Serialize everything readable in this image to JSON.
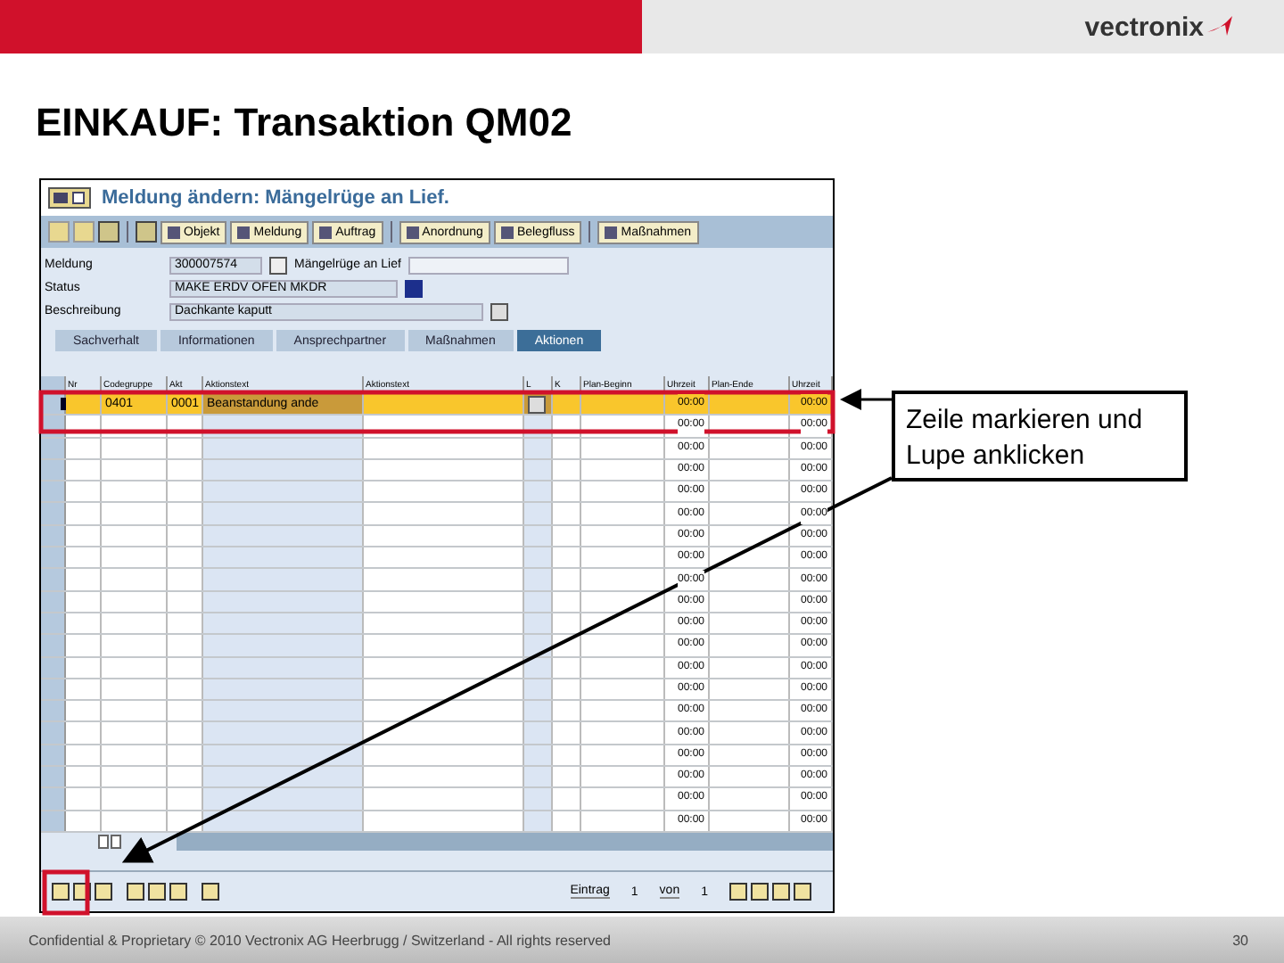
{
  "slide": {
    "logo": "vectronix",
    "title": "EINKAUF: Transaktion QM02",
    "footer": "Confidential & Proprietary © 2010 Vectronix AG Heerbrugg / Switzerland - All rights reserved",
    "page_number": "30"
  },
  "callout": {
    "text": "Zeile markieren und Lupe anklicken"
  },
  "sap_window": {
    "title": "Meldung ändern: Mängelrüge an Lief.",
    "toolbar_buttons": [
      "Objekt",
      "Meldung",
      "Auftrag",
      "Anordnung",
      "Belegfluss",
      "Maßnahmen"
    ],
    "fields": {
      "notification_label": "Meldung",
      "notification": "300007574",
      "type_text": "Mängelrüge an Lief",
      "status_label": "Status",
      "status": "MAKE ERDV OFEN MKDR",
      "description_label": "Beschreibung",
      "description": "Dachkante kaputt"
    },
    "tabs": [
      {
        "label": "Sachverhalt",
        "selected": false
      },
      {
        "label": "Informationen",
        "selected": false
      },
      {
        "label": "Ansprechpartner",
        "selected": false
      },
      {
        "label": "Maßnahmen",
        "selected": false
      },
      {
        "label": "Aktionen",
        "selected": true
      }
    ],
    "table": {
      "columns": [
        "Nr",
        "Codegruppe",
        "Akt",
        "Aktionstext",
        "Aktionstext",
        "L",
        "K",
        "Plan-Beginn",
        "Uhrzeit",
        "Plan-Ende",
        "Uhrzeit"
      ],
      "rows": [
        {
          "selected": true,
          "code_group": "0401",
          "code": "0001",
          "text": "Beanstandung ande",
          "time_1": "00:00",
          "time_2": "00:00"
        },
        {
          "selected": false,
          "time_1": "00:00",
          "time_2": "00:00"
        },
        {
          "selected": false,
          "time_1": "00:00",
          "time_2": "00:00"
        },
        {
          "selected": false,
          "time_1": "00:00",
          "time_2": "00:00"
        },
        {
          "selected": false,
          "time_1": "00:00",
          "time_2": "00:00"
        },
        {
          "selected": false,
          "time_1": "00:00",
          "time_2": "00:00"
        },
        {
          "selected": false,
          "time_1": "00:00",
          "time_2": "00:00"
        },
        {
          "selected": false,
          "time_1": "00:00",
          "time_2": "00:00"
        },
        {
          "selected": false,
          "time_1": "00:00",
          "time_2": "00:00"
        },
        {
          "selected": false,
          "time_1": "00:00",
          "time_2": "00:00"
        },
        {
          "selected": false,
          "time_1": "00:00",
          "time_2": "00:00"
        },
        {
          "selected": false,
          "time_1": "00:00",
          "time_2": "00:00"
        },
        {
          "selected": false,
          "time_1": "00:00",
          "time_2": "00:00"
        },
        {
          "selected": false,
          "time_1": "00:00",
          "time_2": "00:00"
        },
        {
          "selected": false,
          "time_1": "00:00",
          "time_2": "00:00"
        },
        {
          "selected": false,
          "time_1": "00:00",
          "time_2": "00:00"
        },
        {
          "selected": false,
          "time_1": "00:00",
          "time_2": "00:00"
        },
        {
          "selected": false,
          "time_1": "00:00",
          "time_2": "00:00"
        },
        {
          "selected": false,
          "time_1": "00:00",
          "time_2": "00:00"
        },
        {
          "selected": false,
          "time_1": "00:00",
          "time_2": "00:00"
        }
      ]
    },
    "footer": {
      "entry_label": "Eintrag",
      "entry": "1",
      "of_label": "von",
      "total": "1"
    }
  }
}
